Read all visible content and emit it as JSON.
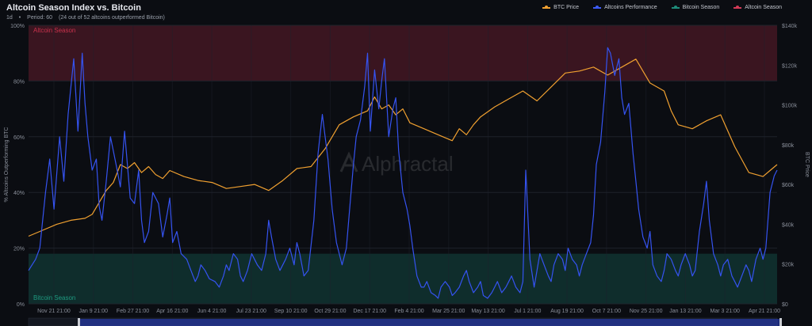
{
  "header": {
    "title": "Altcoin Season Index vs. Bitcoin",
    "timeframe": "1d",
    "period": "Period: 60",
    "outperformed": "(24 out of 52 altcoins outperformed Bitcoin)"
  },
  "legend": [
    {
      "label": "BTC Price",
      "color": "#f0a030"
    },
    {
      "label": "Altcoins Performance",
      "color": "#3d5bf5"
    },
    {
      "label": "Bitcoin Season",
      "color": "#1e8c7a"
    },
    {
      "label": "Altcoin Season",
      "color": "#d23a56"
    }
  ],
  "watermark": "Alphractal",
  "colors": {
    "btc": "#f0a030",
    "alt": "#3553f0",
    "altSeasonZone": "#3a1520",
    "btcSeasonZone": "#0f2d2c",
    "altSeasonText": "#c8324c",
    "btcSeasonText": "#1e9a80",
    "grid": "#1e222b",
    "axisText": "#8a8f9a",
    "bg": "#0b0d12",
    "navigator": "#2b45d0"
  },
  "chart_data": {
    "type": "line",
    "title": "Altcoin Season Index vs. Bitcoin",
    "ylabel_left": "% Altcoins Outperforming BTC",
    "ylabel_right": "BTC Price",
    "ylim_left": [
      0,
      100
    ],
    "ylim_right": [
      0,
      140000
    ],
    "left_ticks": [
      "0%",
      "20%",
      "40%",
      "60%",
      "80%",
      "100%"
    ],
    "right_ticks": [
      "$0",
      "$20k",
      "$40k",
      "$60k",
      "$80k",
      "$100k",
      "$120k",
      "$140k"
    ],
    "x_ticks": [
      "Nov 21 21:00",
      "Jan 9 21:00",
      "Feb 27 21:00",
      "Apr 16 21:00",
      "Jun 4 21:00",
      "Jul 23 21:00",
      "Sep 10 21:00",
      "Oct 29 21:00",
      "Dec 17 21:00",
      "Feb 4 21:00",
      "Mar 25 21:00",
      "May 13 21:00",
      "Jul 1 21:00",
      "Aug 19 21:00",
      "Oct 7 21:00",
      "Nov 25 21:00",
      "Jan 13 21:00",
      "Mar 3 21:00",
      "Apr 21 21:00"
    ],
    "zones": [
      {
        "label": "Altcoin Season",
        "from": 80,
        "to": 100
      },
      {
        "label": "Bitcoin Season",
        "from": 0,
        "to": 18
      }
    ],
    "x_range": [
      0,
      530
    ],
    "series": [
      {
        "name": "BTC Price",
        "axis": "right",
        "x": [
          0,
          10,
          20,
          30,
          40,
          45,
          50,
          55,
          60,
          65,
          70,
          75,
          80,
          85,
          90,
          95,
          100,
          110,
          120,
          130,
          140,
          150,
          160,
          170,
          180,
          190,
          200,
          210,
          220,
          230,
          240,
          245,
          250,
          255,
          260,
          265,
          270,
          280,
          290,
          300,
          305,
          310,
          315,
          320,
          330,
          340,
          350,
          360,
          370,
          380,
          390,
          400,
          410,
          420,
          430,
          440,
          450,
          455,
          460,
          470,
          480,
          490,
          500,
          510,
          520,
          525,
          530
        ],
        "y": [
          34000,
          37000,
          40000,
          42000,
          43000,
          45000,
          51000,
          57000,
          61000,
          70000,
          68000,
          71000,
          66000,
          69000,
          65000,
          63000,
          67000,
          64000,
          62000,
          61000,
          58000,
          59000,
          60000,
          57000,
          62000,
          68000,
          69000,
          78000,
          90000,
          94000,
          97000,
          104000,
          98000,
          100000,
          95000,
          98000,
          91000,
          88000,
          85000,
          82000,
          88000,
          85000,
          90000,
          94000,
          99000,
          103000,
          107000,
          102000,
          109000,
          116000,
          117000,
          119000,
          115000,
          119000,
          123000,
          111000,
          107000,
          97000,
          90000,
          88000,
          92000,
          95000,
          79000,
          66000,
          64000,
          67000,
          70000
        ]
      },
      {
        "name": "Altcoins Performance",
        "axis": "left",
        "x": [
          0,
          5,
          8,
          12,
          15,
          18,
          22,
          25,
          28,
          32,
          35,
          38,
          40,
          42,
          45,
          48,
          50,
          52,
          55,
          58,
          62,
          65,
          68,
          72,
          75,
          78,
          80,
          82,
          85,
          88,
          92,
          95,
          98,
          100,
          102,
          105,
          108,
          112,
          115,
          118,
          120,
          122,
          125,
          128,
          132,
          135,
          138,
          140,
          142,
          145,
          148,
          150,
          152,
          155,
          158,
          162,
          165,
          168,
          170,
          172,
          175,
          178,
          182,
          185,
          188,
          190,
          192,
          195,
          198,
          202,
          205,
          208,
          210,
          212,
          215,
          218,
          220,
          222,
          225,
          228,
          230,
          232,
          235,
          238,
          240,
          242,
          245,
          248,
          250,
          252,
          255,
          258,
          260,
          262,
          265,
          268,
          270,
          272,
          275,
          278,
          280,
          282,
          285,
          288,
          290,
          292,
          295,
          298,
          300,
          302,
          305,
          308,
          310,
          312,
          315,
          318,
          320,
          322,
          325,
          328,
          330,
          332,
          335,
          338,
          340,
          342,
          345,
          348,
          350,
          352,
          355,
          358,
          360,
          362,
          365,
          368,
          370,
          372,
          375,
          378,
          380,
          382,
          385,
          388,
          390,
          392,
          395,
          398,
          400,
          402,
          405,
          408,
          410,
          412,
          415,
          418,
          420,
          422,
          425,
          428,
          430,
          432,
          435,
          438,
          440,
          442,
          445,
          448,
          450,
          452,
          455,
          458,
          460,
          462,
          465,
          468,
          470,
          472,
          475,
          478,
          480,
          482,
          485,
          488,
          490,
          492,
          495,
          498,
          500,
          502,
          505,
          508,
          510,
          512,
          515,
          518,
          520,
          522,
          525,
          528,
          530
        ],
        "y": [
          12,
          16,
          20,
          40,
          52,
          34,
          60,
          44,
          68,
          88,
          62,
          90,
          72,
          60,
          48,
          52,
          35,
          30,
          44,
          60,
          50,
          42,
          62,
          38,
          36,
          48,
          30,
          22,
          26,
          40,
          36,
          24,
          32,
          38,
          22,
          26,
          18,
          16,
          12,
          8,
          10,
          14,
          12,
          9,
          8,
          6,
          10,
          14,
          12,
          18,
          16,
          10,
          8,
          12,
          18,
          14,
          12,
          18,
          30,
          24,
          16,
          12,
          16,
          20,
          14,
          22,
          18,
          10,
          12,
          30,
          54,
          68,
          60,
          52,
          34,
          22,
          18,
          14,
          20,
          38,
          50,
          60,
          66,
          78,
          90,
          62,
          84,
          70,
          80,
          88,
          60,
          70,
          74,
          55,
          40,
          34,
          28,
          20,
          10,
          6,
          6,
          8,
          4,
          3,
          2,
          6,
          8,
          6,
          3,
          4,
          6,
          10,
          12,
          8,
          4,
          6,
          8,
          3,
          2,
          4,
          6,
          8,
          4,
          6,
          8,
          10,
          6,
          4,
          8,
          48,
          16,
          6,
          12,
          18,
          14,
          10,
          8,
          14,
          18,
          16,
          12,
          20,
          16,
          14,
          10,
          14,
          18,
          22,
          32,
          50,
          58,
          76,
          92,
          90,
          82,
          88,
          74,
          68,
          72,
          54,
          44,
          34,
          24,
          20,
          26,
          14,
          10,
          8,
          12,
          18,
          16,
          12,
          10,
          14,
          18,
          14,
          10,
          12,
          26,
          36,
          44,
          30,
          18,
          14,
          10,
          14,
          16,
          10,
          8,
          6,
          10,
          14,
          12,
          8,
          16,
          20,
          16,
          20,
          40,
          46,
          48
        ]
      }
    ]
  }
}
